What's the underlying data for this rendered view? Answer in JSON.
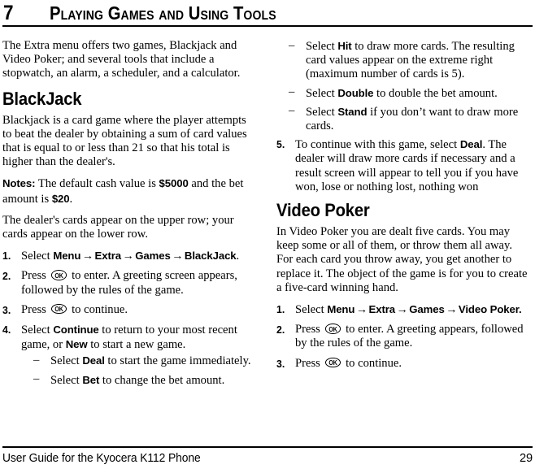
{
  "header": {
    "chapter_number": "7",
    "chapter_title": "Playing Games and Using Tools"
  },
  "footer": {
    "guide_text": "User Guide for the Kyocera K112 Phone",
    "page_number": "29"
  },
  "icons": {
    "ok_key_label": "OK"
  },
  "left_column": {
    "intro_paragraph": "The Extra menu offers two games, Blackjack and Video Poker; and several tools that include a stopwatch, an alarm, a scheduler, and a calculator.",
    "blackjack_heading": "BlackJack",
    "blackjack_paragraph": "Blackjack is a card game where the player attempts to beat the dealer by obtaining a sum of card values that is equal to or less than 21 so that his total is higher than the dealer's.",
    "notes": {
      "label": "Notes:",
      "text_1": " The default cash value is ",
      "value_cash": "$5000",
      "text_2": " and the bet amount is ",
      "value_bet": "$20",
      "text_3": "."
    },
    "dealer_paragraph": "The dealer's cards appear on the upper row; your cards appear on the lower row.",
    "steps": [
      {
        "number": "1.",
        "parts": {
          "lead": "Select ",
          "ui_1": "Menu",
          "arrow_1": "→",
          "ui_2": "Extra",
          "arrow_2": "→",
          "ui_3": "Games",
          "arrow_3": "→",
          "ui_4": "BlackJack",
          "tail": "."
        }
      },
      {
        "number": "2.",
        "parts": {
          "lead": "Press ",
          "tail": " to enter. A greeting screen appears, followed by the rules of the game."
        }
      },
      {
        "number": "3.",
        "parts": {
          "lead": "Press ",
          "tail": " to continue."
        }
      },
      {
        "number": "4.",
        "parts": {
          "lead": "Select ",
          "ui_1": "Continue",
          "mid_1": " to return to your most recent game, or ",
          "ui_2": "New",
          "tail": " to start a new game."
        },
        "sub_items": [
          {
            "dash": "–",
            "lead": "Select ",
            "ui": "Deal",
            "tail": " to start the game immediately."
          },
          {
            "dash": "–",
            "lead": "Select ",
            "ui": "Bet",
            "tail": " to change the bet amount."
          }
        ]
      }
    ]
  },
  "right_column": {
    "continued_dash_items": [
      {
        "dash": "–",
        "lead": "Select ",
        "ui": "Hit",
        "tail": " to draw more cards. The resulting card values appear on the extreme right (maximum number of cards is 5)."
      },
      {
        "dash": "–",
        "lead": "Select ",
        "ui": "Double",
        "tail": " to double the bet amount."
      },
      {
        "dash": "–",
        "lead": "Select ",
        "ui": "Stand",
        "tail": " if you don’t want to draw more cards."
      }
    ],
    "step_5": {
      "number": "5.",
      "lead": "To continue with this game, select ",
      "ui": "Deal",
      "tail": ". The dealer will draw more cards if necessary and a result screen will appear to tell you if you have won, lose or nothing lost, nothing won"
    },
    "video_poker_heading": "Video Poker",
    "video_poker_paragraph": "In Video Poker you are dealt five cards. You may keep some or all of them, or throw them all away. For each card you throw away, you get another to replace it. The object of the game is for you to create a five-card winning hand.",
    "steps": [
      {
        "number": "1.",
        "parts": {
          "lead": "Select ",
          "ui_1": "Menu",
          "arrow_1": "→",
          "ui_2": "Extra",
          "arrow_2": "→",
          "ui_3": "Games",
          "arrow_3": "→",
          "ui_4": "Video Poker.",
          "tail": ""
        }
      },
      {
        "number": "2.",
        "parts": {
          "lead": "Press ",
          "tail": " to enter. A greeting appears, followed by the rules of the game."
        }
      },
      {
        "number": "3.",
        "parts": {
          "lead": "Press ",
          "tail": " to continue."
        }
      }
    ]
  }
}
